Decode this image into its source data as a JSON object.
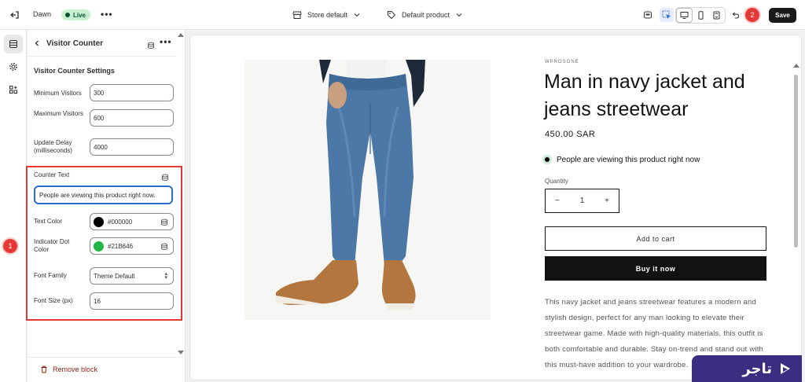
{
  "topbar": {
    "theme_name": "Dawn",
    "live_label": "Live",
    "more_label": "•••",
    "store_selector": "Store default",
    "product_selector": "Default product",
    "save_label": "Save"
  },
  "annotations": {
    "step_1": "1",
    "step_2": "2"
  },
  "panel": {
    "title": "Visitor Counter",
    "more_label": "•••",
    "settings_title": "Visitor Counter Settings",
    "fields": {
      "min_visitors": {
        "label": "Minimum Visitors",
        "value": "300"
      },
      "max_visitors": {
        "label": "Maximum Visitors",
        "value": "600"
      },
      "update_delay": {
        "label": "Update Delay (milliseconds)",
        "value": "4000"
      },
      "counter_text": {
        "label": "Counter Text",
        "value": "People are viewing this product right now."
      },
      "text_color": {
        "label": "Text Color",
        "value": "#000000"
      },
      "dot_color": {
        "label": "Indicator Dot Color",
        "value": "#21B646"
      },
      "font_family": {
        "label": "Font Family",
        "value": "Theme Default"
      },
      "font_size": {
        "label": "Font Size (px)",
        "value": "16"
      }
    },
    "remove_label": "Remove block"
  },
  "product": {
    "vendor": "WPROSONE",
    "title": "Man in navy jacket and jeans streetwear",
    "price": "450.00 SAR",
    "viewers_text": "People are viewing this product right now",
    "quantity_label": "Quantity",
    "quantity_value": "1",
    "minus": "−",
    "plus": "+",
    "add_to_cart": "Add to cart",
    "buy_now": "Buy it now",
    "description": "This navy jacket and jeans streetwear features a modern and stylish design, perfect for any man looking to elevate their streetwear game. Made with high-quality materials, this outfit is both comfortable and durable. Stay on-trend and stand out with this must-have addition to your wardrobe."
  },
  "watermark": {
    "text": "تاجر"
  },
  "colors": {
    "accent_blue": "#2c6ecb",
    "annotation_red": "#e53935",
    "swatch_black": "#000000",
    "swatch_green": "#21B646",
    "brand_purple": "#3c2d80"
  }
}
